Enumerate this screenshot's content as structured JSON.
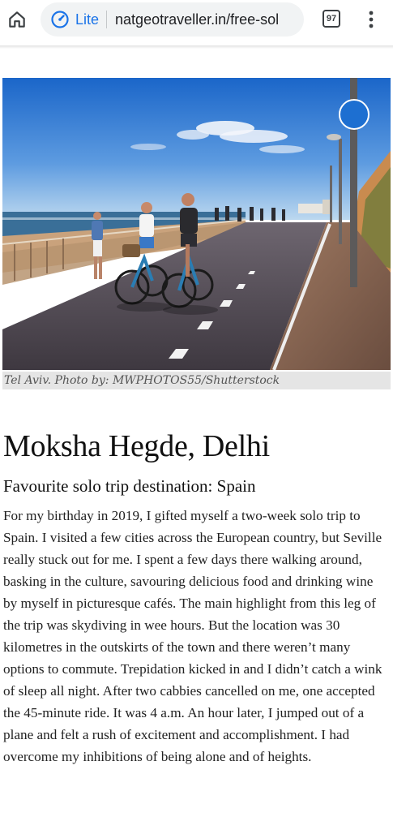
{
  "browser": {
    "lite_label": "Lite",
    "url": "natgeotraveller.in/free-sol",
    "tab_count": "97",
    "icons": {
      "home": "home-icon",
      "lite": "lite-mode-gauge-icon",
      "menu": "more-vert-icon"
    },
    "accent_color": "#1a73e8"
  },
  "article": {
    "image_caption": "Tel Aviv. Photo by: MWPHOTOS55/Shutterstock",
    "author_heading": "Moksha Hegde, Delhi",
    "sub_heading": "Favourite solo trip destination: Spain",
    "body": "For my birthday in 2019, I gifted myself a two-week solo trip to Spain. I visited a few cities across the European country, but Seville really stuck out for me. I spent a few days there walking around, basking in the culture, savouring delicious food and drinking wine by myself in picturesque cafés. The main highlight from this leg of the trip was skydiving in wee hours. But the location was 30 kilometres in the outskirts of the town and there weren’t many options to commute. Trepidation kicked in and I didn’t catch a wink of sleep all night. After two cabbies cancelled on me, one accepted the 45-minute ride. It was 4 a.m. An hour later, I jumped out of a plane and felt a rush of excitement and accomplishment. I had overcome my inhibitions of being alone and of heights."
  }
}
